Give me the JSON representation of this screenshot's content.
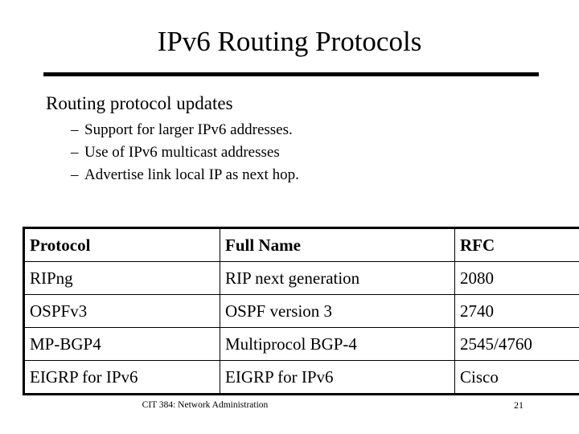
{
  "slide": {
    "title": "IPv6 Routing Protocols",
    "body": {
      "heading": "Routing protocol updates",
      "dash": "–",
      "sub_bullets": [
        "Support for larger IPv6 addresses.",
        "Use of IPv6 multicast addresses",
        "Advertise link local IP as next hop."
      ]
    },
    "table": {
      "headers": [
        "Protocol",
        "Full Name",
        "RFC"
      ],
      "rows": [
        [
          "RIPng",
          "RIP next generation",
          "2080"
        ],
        [
          "OSPFv3",
          "OSPF version 3",
          "2740"
        ],
        [
          "MP-BGP4",
          "Multiprocol BGP-4",
          "2545/4760"
        ],
        [
          "EIGRP for IPv6",
          "EIGRP for IPv6",
          "Cisco"
        ]
      ]
    },
    "footer": {
      "course": "CIT 384: Network Administration",
      "page_number": "21"
    },
    "colors": {
      "background": "#ffffff",
      "text": "#000000",
      "rule": "#000000"
    }
  }
}
